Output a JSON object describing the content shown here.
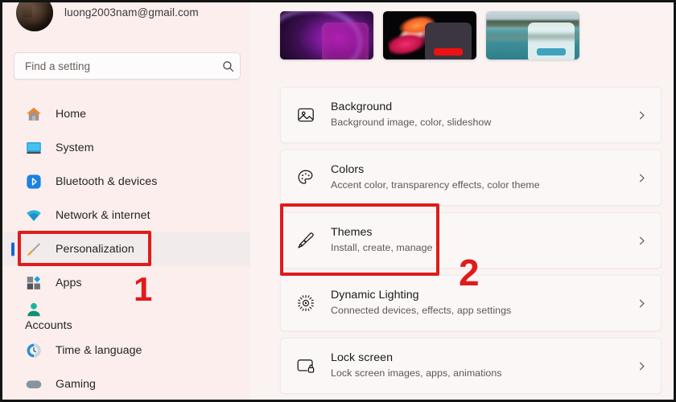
{
  "account": {
    "email": "luong2003nam@gmail.com",
    "avatar_name": "user-avatar"
  },
  "search": {
    "placeholder": "Find a setting",
    "value": "",
    "icon": "search-icon"
  },
  "sidebar": {
    "items": [
      {
        "label": "Home",
        "icon": "home-icon",
        "selected": false
      },
      {
        "label": "System",
        "icon": "system-icon",
        "selected": false
      },
      {
        "label": "Bluetooth & devices",
        "icon": "bluetooth-icon",
        "selected": false
      },
      {
        "label": "Network & internet",
        "icon": "network-icon",
        "selected": false
      },
      {
        "label": "Personalization",
        "icon": "brush-icon",
        "selected": true
      },
      {
        "label": "Apps",
        "icon": "apps-icon",
        "selected": false
      },
      {
        "label": "Accounts",
        "icon": "accounts-icon",
        "selected": false
      },
      {
        "label": "Time & language",
        "icon": "clock-icon",
        "selected": false
      },
      {
        "label": "Gaming",
        "icon": "gamepad-icon",
        "selected": false
      }
    ]
  },
  "themes_row": {
    "thumbnails": [
      {
        "name": "theme-thumbnail-purple-bloom",
        "accent": "#af1996"
      },
      {
        "name": "theme-thumbnail-dark-flower",
        "accent": "#ee1111"
      },
      {
        "name": "theme-thumbnail-lake",
        "accent": "#3fa3bd"
      }
    ]
  },
  "settings_cards": [
    {
      "title": "Background",
      "subtitle": "Background image, color, slideshow",
      "icon": "picture-icon",
      "name": "card-background"
    },
    {
      "title": "Colors",
      "subtitle": "Accent color, transparency effects, color theme",
      "icon": "palette-icon",
      "name": "card-colors"
    },
    {
      "title": "Themes",
      "subtitle": "Install, create, manage",
      "icon": "paintbrush-icon",
      "name": "card-themes"
    },
    {
      "title": "Dynamic Lighting",
      "subtitle": "Connected devices, effects, app settings",
      "icon": "dynamic-lighting-icon",
      "name": "card-dynamic-lighting"
    },
    {
      "title": "Lock screen",
      "subtitle": "Lock screen images, apps, animations",
      "icon": "lock-screen-icon",
      "name": "card-lock-screen"
    }
  ],
  "annotations": {
    "color": "#e01b1b",
    "step_one": "1",
    "step_two": "2"
  },
  "colors": {
    "sidebar_bg": "#fbeeed",
    "content_bg": "#fbf3f2",
    "card_bg": "#fbf7f7",
    "selection_accent": "#1565d8",
    "annotation_red": "#e01b1b"
  }
}
